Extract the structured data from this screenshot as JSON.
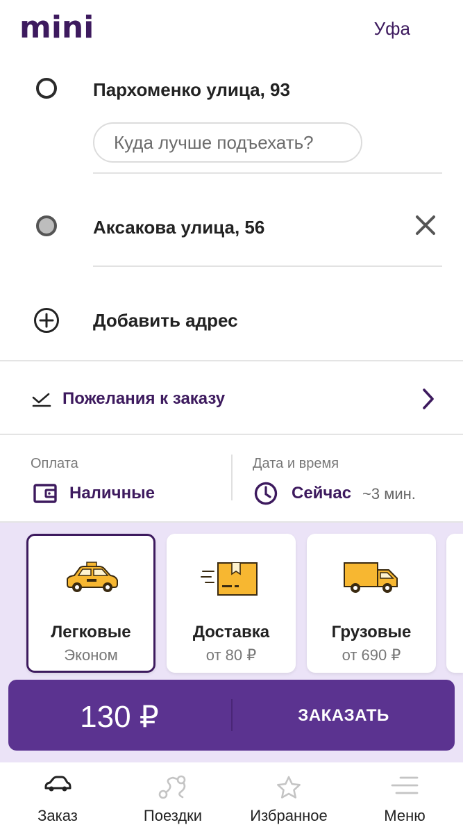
{
  "header": {
    "logo": "mini",
    "city": "Уфа"
  },
  "route": {
    "from": "Пархоменко улица, 93",
    "entrance_placeholder": "Куда лучше подъехать?",
    "to": "Аксакова улица, 56",
    "add_address": "Добавить адрес"
  },
  "wishes": {
    "label": "Пожелания к заказу"
  },
  "payment": {
    "label": "Оплата",
    "value": "Наличные"
  },
  "datetime": {
    "label": "Дата и время",
    "value": "Сейчас",
    "eta": "~3 мин."
  },
  "tariffs": [
    {
      "name": "Легковые",
      "sub": "Эконом",
      "selected": true
    },
    {
      "name": "Доставка",
      "sub": "от 80 ₽",
      "selected": false
    },
    {
      "name": "Грузовые",
      "sub": "от 690 ₽",
      "selected": false
    }
  ],
  "order": {
    "price": "130 ₽",
    "button": "ЗАКАЗАТЬ"
  },
  "nav": [
    {
      "label": "Заказ"
    },
    {
      "label": "Поездки"
    },
    {
      "label": "Избранное"
    },
    {
      "label": "Меню"
    }
  ],
  "colors": {
    "brand": "#3d1a5e",
    "accent_bar": "#5b3390",
    "tariff_bg": "#ebe3f7",
    "icon_yellow": "#f7b731"
  }
}
